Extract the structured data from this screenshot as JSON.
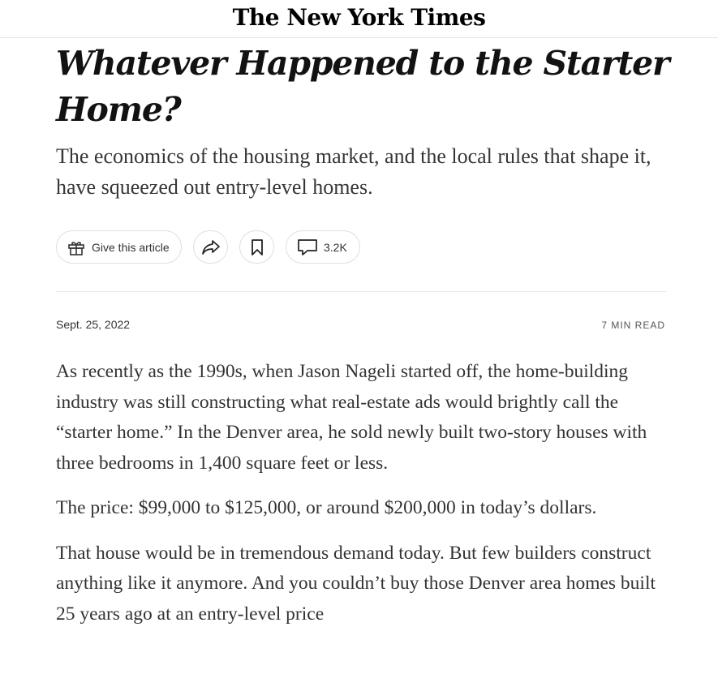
{
  "masthead": {
    "logo_text": "The New York Times"
  },
  "article": {
    "headline": "Whatever Happened to the Starter Home?",
    "summary": "The economics of the housing market, and the local rules that shape it, have squeezed out entry-level homes.",
    "date": "Sept. 25, 2022",
    "read_time": "7 MIN READ",
    "paragraphs": [
      "As recently as the 1990s, when Jason Nageli started off, the home-building industry was still constructing what real-estate ads would brightly call the “starter home.” In the Denver area, he sold newly built two-story houses with three bedrooms in 1,400 square feet or less.",
      "The price: $99,000 to $125,000, or around $200,000 in today’s dollars.",
      "That house would be in tremendous demand today. But few builders construct anything like it anymore. And you couldn’t buy those Denver area homes built 25 years ago at an entry-level price"
    ]
  },
  "actions": {
    "gift_label": "Give this article",
    "gift_icon": "gift-icon",
    "share_icon": "share-icon",
    "bookmark_icon": "bookmark-icon",
    "comments_icon": "comment-icon",
    "comments_count": "3.2K"
  }
}
